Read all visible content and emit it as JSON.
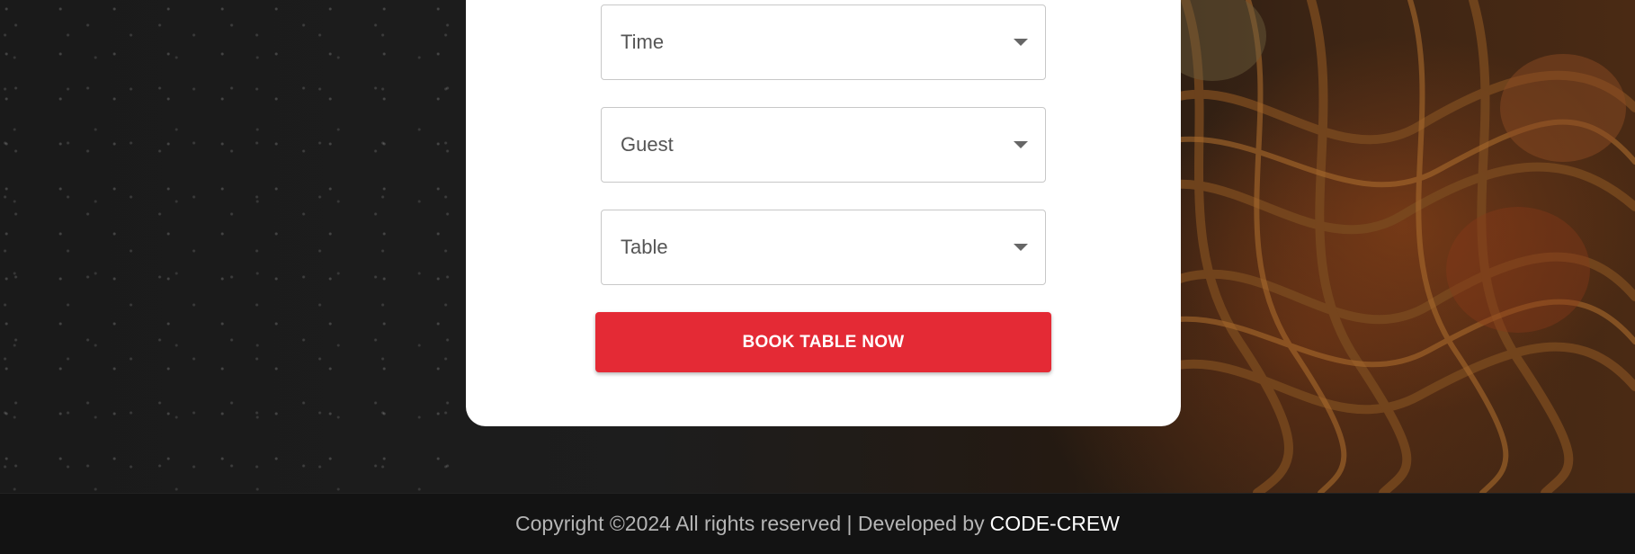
{
  "form": {
    "fields": [
      {
        "placeholder": "Time"
      },
      {
        "placeholder": "Guest"
      },
      {
        "placeholder": "Table"
      }
    ],
    "submit_label": "BOOK TABLE NOW"
  },
  "footer": {
    "text": "Copyright ©2024 All rights reserved | Developed by",
    "brand": "CODE-CREW"
  },
  "colors": {
    "accent": "#e42a35",
    "footer_bg": "#131313"
  },
  "icons": {
    "dropdown": "chevron-down-icon"
  }
}
